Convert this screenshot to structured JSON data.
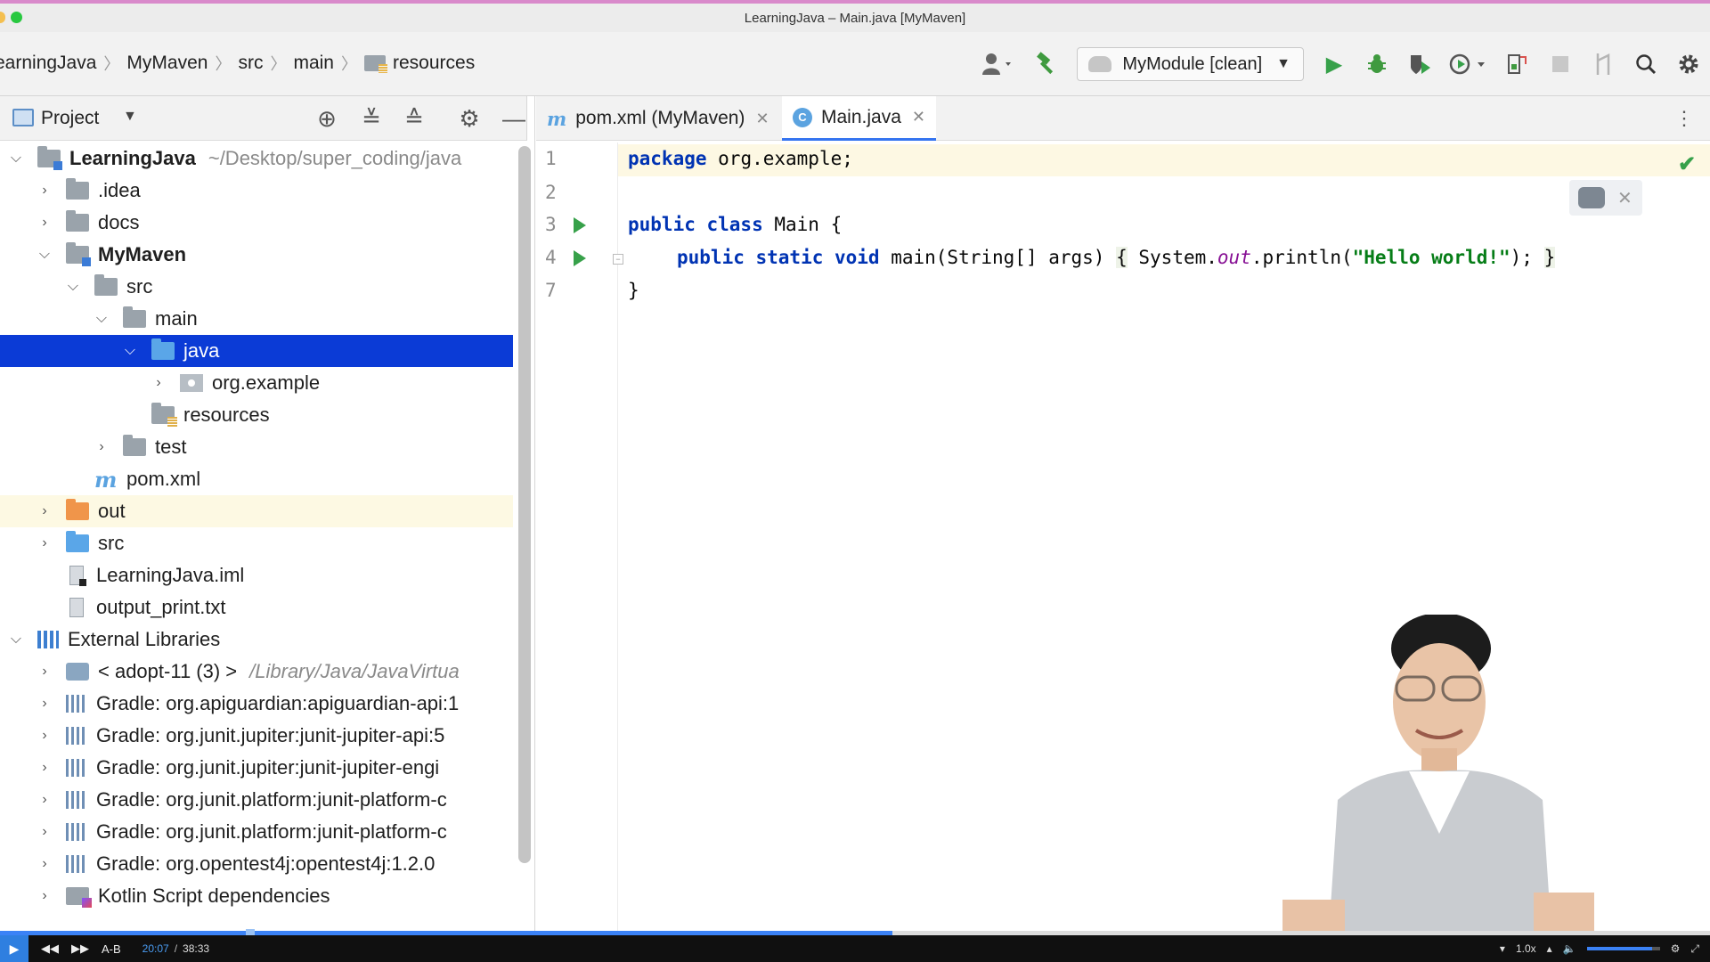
{
  "window": {
    "title": "LearningJava – Main.java [MyMaven]"
  },
  "breadcrumb": [
    "earningJava",
    "MyMaven",
    "src",
    "main",
    "resources"
  ],
  "toolbar": {
    "run_config": "MyModule [clean]",
    "icons": [
      "user-icon",
      "build-hammer-icon",
      "run-icon",
      "debug-icon",
      "coverage-icon",
      "profile-icon",
      "attach-icon",
      "stop-icon",
      "vcs-icon",
      "search-icon",
      "settings-icon"
    ]
  },
  "project_panel": {
    "title": "Project",
    "tree": [
      {
        "label": "LearningJava",
        "path": "~/Desktop/super_coding/java",
        "level": 0,
        "arrow": "open",
        "icon": "folder-module"
      },
      {
        "label": ".idea",
        "level": 1,
        "arrow": "closed",
        "icon": "folder"
      },
      {
        "label": "docs",
        "level": 1,
        "arrow": "closed",
        "icon": "folder"
      },
      {
        "label": "MyMaven",
        "level": 1,
        "arrow": "open",
        "icon": "folder-module",
        "bold": true
      },
      {
        "label": "src",
        "level": 2,
        "arrow": "open",
        "icon": "folder"
      },
      {
        "label": "main",
        "level": 3,
        "arrow": "open",
        "icon": "folder"
      },
      {
        "label": "java",
        "level": 4,
        "arrow": "open",
        "icon": "folder-blue",
        "selected": true
      },
      {
        "label": "org.example",
        "level": 5,
        "arrow": "closed",
        "icon": "package"
      },
      {
        "label": "resources",
        "level": 4,
        "arrow": "none",
        "icon": "folder-res"
      },
      {
        "label": "test",
        "level": 3,
        "arrow": "closed",
        "icon": "folder"
      },
      {
        "label": "pom.xml",
        "level": 2,
        "arrow": "none",
        "icon": "maven"
      },
      {
        "label": "out",
        "level": 1,
        "arrow": "closed",
        "icon": "folder-orange",
        "highlight": true
      },
      {
        "label": "src",
        "level": 1,
        "arrow": "closed",
        "icon": "folder-blue"
      },
      {
        "label": "LearningJava.iml",
        "level": 1,
        "arrow": "none",
        "icon": "file-iml"
      },
      {
        "label": "output_print.txt",
        "level": 1,
        "arrow": "none",
        "icon": "file"
      },
      {
        "label": "External Libraries",
        "level": 0,
        "arrow": "open",
        "icon": "lib-ext"
      },
      {
        "label": "< adopt-11 (3) >",
        "path": "/Library/Java/JavaVirtua",
        "level": 1,
        "arrow": "closed",
        "icon": "jdk"
      },
      {
        "label": "Gradle: org.apiguardian:apiguardian-api:1",
        "level": 1,
        "arrow": "closed",
        "icon": "lib"
      },
      {
        "label": "Gradle: org.junit.jupiter:junit-jupiter-api:5",
        "level": 1,
        "arrow": "closed",
        "icon": "lib"
      },
      {
        "label": "Gradle: org.junit.jupiter:junit-jupiter-engi",
        "level": 1,
        "arrow": "closed",
        "icon": "lib"
      },
      {
        "label": "Gradle: org.junit.platform:junit-platform-c",
        "level": 1,
        "arrow": "closed",
        "icon": "lib"
      },
      {
        "label": "Gradle: org.junit.platform:junit-platform-c",
        "level": 1,
        "arrow": "closed",
        "icon": "lib"
      },
      {
        "label": "Gradle: org.opentest4j:opentest4j:1.2.0",
        "level": 1,
        "arrow": "closed",
        "icon": "lib"
      },
      {
        "label": "Kotlin Script dependencies",
        "level": 1,
        "arrow": "closed",
        "icon": "kts"
      }
    ]
  },
  "editor": {
    "tabs": [
      {
        "label": "pom.xml (MyMaven)",
        "icon": "maven-icon",
        "active": false
      },
      {
        "label": "Main.java",
        "icon": "java-class-icon",
        "active": true
      }
    ],
    "line_numbers": [
      "1",
      "2",
      "3",
      "4",
      "7"
    ],
    "code": {
      "l1_kw": "package",
      "l1_rest": " org.example;",
      "l3_kw": "public class",
      "l3_rest": " Main {",
      "l4_kw": "public static void",
      "l4_mid": " main(String[] args) ",
      "l4_open": "{",
      "l4_sys": " System.",
      "l4_field": "out",
      "l4_call": ".println(",
      "l4_str": "\"Hello world!\"",
      "l4_end": "); ",
      "l4_close": "}",
      "l7": "}"
    }
  },
  "player": {
    "current_time": "20:07",
    "total_time": "38:33",
    "ab_label": "A-B",
    "speed": "1.0x",
    "progress_fraction": 0.522,
    "volume_fraction": 0.9
  },
  "colors": {
    "selection": "#0b3bd6",
    "keyword": "#0033b3",
    "string": "#067d17",
    "accent": "#3574f0"
  }
}
